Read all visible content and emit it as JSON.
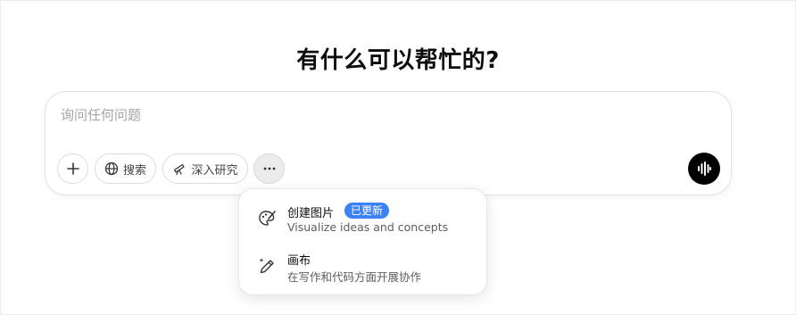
{
  "heading": "有什么可以帮忙的?",
  "composer": {
    "placeholder": "询问任何问题",
    "value": ""
  },
  "toolbar": {
    "add_icon": "plus-icon",
    "search_label": "搜索",
    "search_icon": "globe-icon",
    "research_label": "深入研究",
    "research_icon": "telescope-icon",
    "more_icon": "ellipsis-icon",
    "voice_icon": "voice-waveform-icon"
  },
  "menu": {
    "items": [
      {
        "title": "创建图片",
        "badge": "已更新",
        "description": "Visualize ideas and concepts",
        "icon": "palette-brush-icon"
      },
      {
        "title": "画布",
        "description": "在写作和代码方面开展协作",
        "icon": "pencil-sparkle-icon"
      }
    ]
  },
  "colors": {
    "badge_bg": "#3b82f6",
    "voice_button_bg": "#000000",
    "more_button_bg": "#ececec"
  }
}
